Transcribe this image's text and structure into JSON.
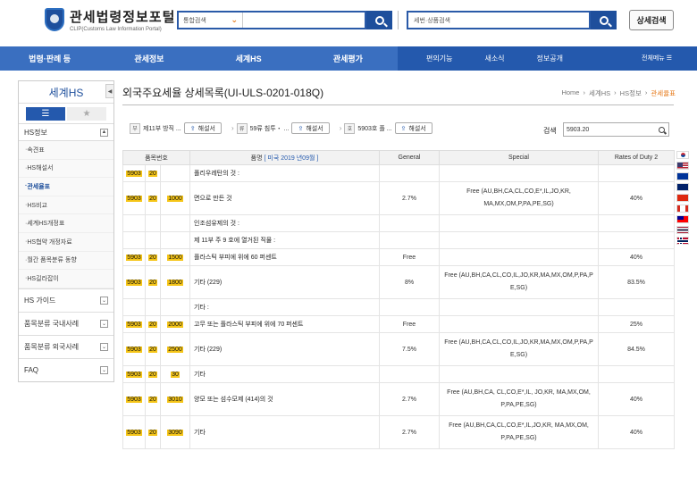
{
  "header": {
    "logo_title": "관세법령정보포털",
    "logo_sub": "CLIP(Customs Law Information Portal)",
    "search1_select": "통합검색",
    "search2_placeholder": "세번·상품검색",
    "detail_search": "상세검색"
  },
  "nav": {
    "main": [
      "법령·판례 등",
      "관세정보",
      "세계HS",
      "관세평가"
    ],
    "sub": [
      "편의기능",
      "새소식",
      "정보공개"
    ],
    "all_menu": "전체메뉴 ☰"
  },
  "sidebar": {
    "title": "세계HS",
    "section_hs": "HS정보",
    "items": [
      "속견표",
      "HS해설서",
      "관세율표",
      "HS비교",
      "세계HS개정표",
      "HS협약 개정자료",
      "월간 품목분류 동향",
      "HS길라잡이"
    ],
    "groups": [
      "HS 가이드",
      "품목분류 국내사례",
      "품목분류 외국사례",
      "FAQ"
    ]
  },
  "page": {
    "title": "외국주요세율 상세목록(UI-ULS-0201-018Q)",
    "breadcrumb": [
      "Home",
      "세계HS",
      "HS정보",
      "관세율표"
    ]
  },
  "filter": {
    "b1": "부",
    "t1": "제11부 방직 ...",
    "b2": "류",
    "t2": "59류 침투・ ...",
    "b3": "호",
    "t3": "5903호 플 ...",
    "btn": "해설서",
    "search_label": "검색",
    "search_value": "5903.20"
  },
  "table": {
    "h_code": "품목번호",
    "h_name": "품명",
    "h_year": "[ 미국  2019 년09월 ]",
    "h_general": "General",
    "h_special": "Special",
    "h_rates2": "Rates of Duty 2",
    "rows": [
      {
        "c1": "5903",
        "c2": "20",
        "c3": "",
        "name": "폴리우레탄의 것 :",
        "gen": "",
        "spec": "",
        "r2": ""
      },
      {
        "c1": "5903",
        "c2": "20",
        "c3": "1000",
        "name": "면으로 만든 것",
        "gen": "2.7%",
        "spec": "Free (AU,BH,CA,CL,CO,E*,IL,JO,KR, MA,MX,OM,P,PA,PE,SG)",
        "r2": "40%"
      },
      {
        "c1": "",
        "c2": "",
        "c3": "",
        "name": "인조섬유제의 것 :",
        "gen": "",
        "spec": "",
        "r2": ""
      },
      {
        "c1": "",
        "c2": "",
        "c3": "",
        "name": "제 11부 주 9 호에 열거된 직물 :",
        "gen": "",
        "spec": "",
        "r2": ""
      },
      {
        "c1": "5903",
        "c2": "20",
        "c3": "1500",
        "name": "플라스틱 부피에 위에 60 퍼센트",
        "gen": "Free",
        "spec": "",
        "r2": "40%"
      },
      {
        "c1": "5903",
        "c2": "20",
        "c3": "1800",
        "name": "기타 (229)",
        "gen": "8%",
        "spec": "Free (AU,BH,CA,CL,CO,IL,JO,KR,MA,MX,OM,P,PA,P E,SG)",
        "r2": "83.5%"
      },
      {
        "c1": "",
        "c2": "",
        "c3": "",
        "name": "기타 :",
        "gen": "",
        "spec": "",
        "r2": ""
      },
      {
        "c1": "5903",
        "c2": "20",
        "c3": "2000",
        "name": "고무 또는 플라스틱 부피에 위에 70 퍼센트",
        "gen": "Free",
        "spec": "",
        "r2": "25%"
      },
      {
        "c1": "5903",
        "c2": "20",
        "c3": "2500",
        "name": "기타 (229)",
        "gen": "7.5%",
        "spec": "Free (AU,BH,CA,CL,CO,IL,JO,KR,MA,MX,OM,P,PA,P E,SG)",
        "r2": "84.5%"
      },
      {
        "c1": "5903",
        "c2": "20",
        "c3": "30",
        "name": "기타",
        "gen": "",
        "spec": "",
        "r2": ""
      },
      {
        "c1": "5903",
        "c2": "20",
        "c3": "3010",
        "name": "양모 또는 섬수모제 (414)의 것",
        "gen": "2.7%",
        "spec": "Free (AU,BH,CA, CL,CO,E*,IL, JO,KR, MA,MX,OM, P,PA,PE,SG)",
        "r2": "40%"
      },
      {
        "c1": "5903",
        "c2": "20",
        "c3": "3090",
        "name": "기타",
        "gen": "2.7%",
        "spec": "Free (AU,BH,CA,CL,CO,E*,IL,JO,KR, MA,MX,OM, P,PA,PE,SG)",
        "r2": "40%"
      }
    ]
  },
  "flags": [
    "kr-flag",
    "us-flag",
    "eu-flag",
    "au-flag",
    "cn-flag",
    "ca-flag",
    "tw-flag",
    "th-flag",
    "no-flag"
  ]
}
